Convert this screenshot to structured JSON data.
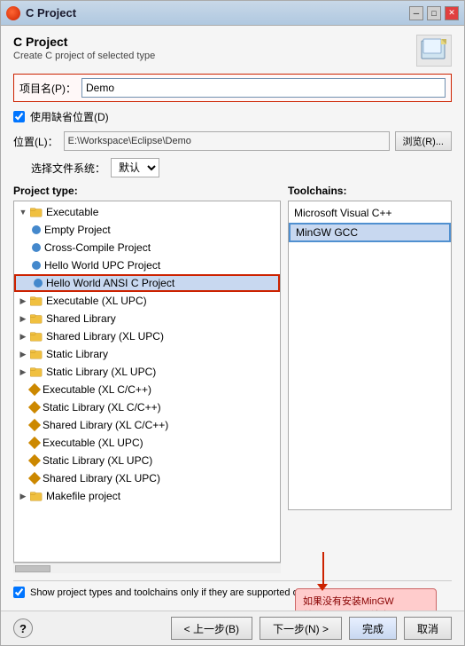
{
  "window": {
    "title": "C Project",
    "icon": "circle-icon"
  },
  "header": {
    "title": "C Project",
    "subtitle": "Create C project of selected type"
  },
  "form": {
    "project_name_label": "项目名(P)：",
    "project_name_value": "Demo",
    "checkbox_default_label": "✓ 使用缺省位置(D)",
    "location_label": "位置(L)：",
    "location_value": "E:\\Workspace\\Eclipse\\Demo",
    "browse_label": "浏览(R)...",
    "filesystem_label": "选择文件系统：",
    "filesystem_value": "默认"
  },
  "project_type": {
    "label": "Project type:",
    "items": [
      {
        "indent": 0,
        "type": "folder",
        "label": "Executable",
        "expanded": true
      },
      {
        "indent": 1,
        "type": "bullet",
        "color": "#4488cc",
        "label": "Empty Project"
      },
      {
        "indent": 1,
        "type": "bullet",
        "color": "#4488cc",
        "label": "Cross-Compile Project"
      },
      {
        "indent": 1,
        "type": "bullet",
        "color": "#4488cc",
        "label": "Hello World UPC Project"
      },
      {
        "indent": 1,
        "type": "bullet",
        "color": "#4488cc",
        "label": "Hello World ANSI C Project",
        "highlighted": true
      },
      {
        "indent": 0,
        "type": "folder",
        "label": "Executable (XL UPC)"
      },
      {
        "indent": 0,
        "type": "folder",
        "label": "Shared Library"
      },
      {
        "indent": 0,
        "type": "folder",
        "label": "Shared Library (XL UPC)"
      },
      {
        "indent": 0,
        "type": "folder",
        "label": "Static Library"
      },
      {
        "indent": 0,
        "type": "folder",
        "label": "Static Library (XL UPC)"
      },
      {
        "indent": 0,
        "type": "diamond",
        "color": "#cc8800",
        "label": "Executable (XL C/C++)"
      },
      {
        "indent": 0,
        "type": "diamond",
        "color": "#cc8800",
        "label": "Static Library (XL C/C++)"
      },
      {
        "indent": 0,
        "type": "diamond",
        "color": "#cc8800",
        "label": "Shared Library (XL C/C++)"
      },
      {
        "indent": 0,
        "type": "diamond",
        "color": "#cc8800",
        "label": "Executable (XL UPC)"
      },
      {
        "indent": 0,
        "type": "diamond",
        "color": "#cc8800",
        "label": "Static Library (XL UPC)"
      },
      {
        "indent": 0,
        "type": "diamond",
        "color": "#cc8800",
        "label": "Shared Library (XL UPC)"
      },
      {
        "indent": 0,
        "type": "folder",
        "label": "Makefile project"
      }
    ]
  },
  "toolchains": {
    "label": "Toolchains:",
    "items": [
      {
        "label": "Microsoft Visual C++",
        "selected": false
      },
      {
        "label": "MinGW GCC",
        "selected": true
      }
    ],
    "annotation": "如果没有安装MinGW\n并且配置path环境变\n量这个是不会出现的"
  },
  "bottom_checkbox": {
    "label": "Show project types and toolchains only if they are supported on the platform",
    "checked": true
  },
  "footer": {
    "help_label": "?",
    "back_label": "< 上一步(B)",
    "next_label": "下一步(N) >",
    "finish_label": "完成",
    "cancel_label": "取消"
  }
}
